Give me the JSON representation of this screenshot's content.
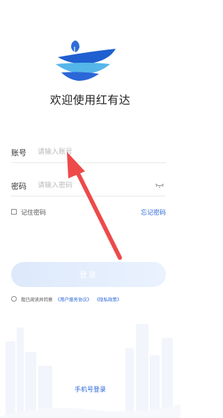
{
  "app": {
    "title": "欢迎使用红有达"
  },
  "form": {
    "account_label": "账号",
    "account_placeholder": "请输入账号",
    "password_label": "密码",
    "password_placeholder": "请输入密码",
    "remember_label": "记住密码",
    "forgot_label": "忘记密码"
  },
  "actions": {
    "login_label": "登录",
    "phone_login_label": "手机号登录"
  },
  "agreement": {
    "prefix": "我已阅读并同意",
    "user_agreement": "《用户服务协议》",
    "privacy_policy": "《隐私政策》"
  },
  "colors": {
    "accent": "#2c67d8",
    "annotation_arrow": "#ee4a4a"
  },
  "icons": [
    "logo-icon",
    "eye-closed-icon",
    "checkbox-icon",
    "radio-icon"
  ]
}
